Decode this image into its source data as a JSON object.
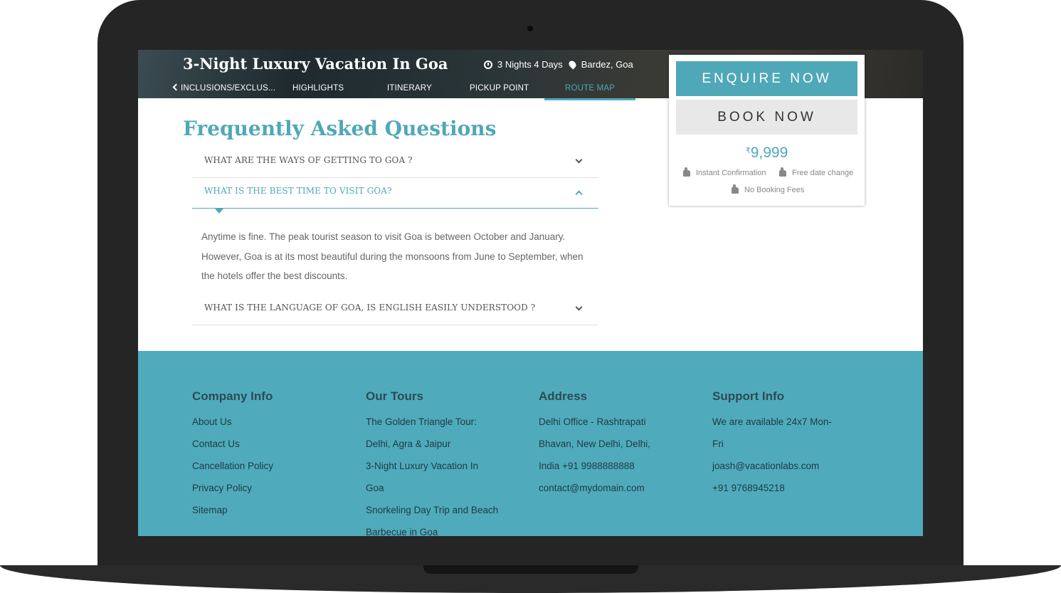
{
  "header": {
    "title": "3-Night Luxury Vacation In Goa",
    "duration": "3 Nights 4 Days",
    "location": "Bardez, Goa",
    "nav": [
      {
        "label": "INCLUSIONS/EXCLUS..."
      },
      {
        "label": "HIGHLIGHTS"
      },
      {
        "label": "ITINERARY"
      },
      {
        "label": "PICKUP POINT"
      },
      {
        "label": "ROUTE MAP"
      }
    ],
    "active_nav": "ROUTE MAP"
  },
  "faq": {
    "title": "Frequently Asked Questions",
    "items": [
      {
        "question": "WHAT ARE THE WAYS OF GETTING TO GOA ?"
      },
      {
        "question": "WHAT IS THE BEST TIME TO VISIT GOA?",
        "answer": "Anytime is fine. The peak tourist season to visit Goa is between October and January. However, Goa is at its most beautiful during the monsoons from June to September, when the hotels offer the best discounts."
      },
      {
        "question": "WHAT IS THE LANGUAGE OF GOA, IS ENGLISH EASILY UNDERSTOOD ?"
      }
    ]
  },
  "booking": {
    "enquire_label": "ENQUIRE NOW",
    "book_label": "BOOK NOW",
    "currency": "₹",
    "price": "9,999",
    "perks": [
      "Instant Confirmation",
      "Free date change",
      "No Booking Fees"
    ]
  },
  "footer": {
    "company": {
      "heading": "Company Info",
      "links": [
        "About Us",
        "Contact Us",
        "Cancellation Policy",
        "Privacy Policy",
        "Sitemap"
      ]
    },
    "tours": {
      "heading": "Our Tours",
      "lines": [
        "The Golden Triangle Tour:",
        "Delhi, Agra & Jaipur",
        "3-Night Luxury Vacation In",
        "Goa",
        "Snorkeling Day Trip and Beach",
        "Barbecue in Goa"
      ]
    },
    "address": {
      "heading": "Address",
      "lines": [
        "Delhi Office - Rashtrapati",
        "Bhavan, New Delhi, Delhi,",
        "India +91 9988888888",
        "contact@mydomain.com"
      ]
    },
    "support": {
      "heading": "Support Info",
      "lines": [
        "We are available 24x7 Mon-",
        "Fri",
        "joash@vacationlabs.com",
        "+91 9768945218"
      ]
    }
  },
  "colors": {
    "accent": "#4fa8b8",
    "footer_bg": "#4fabbc",
    "laptop": "#252525"
  }
}
